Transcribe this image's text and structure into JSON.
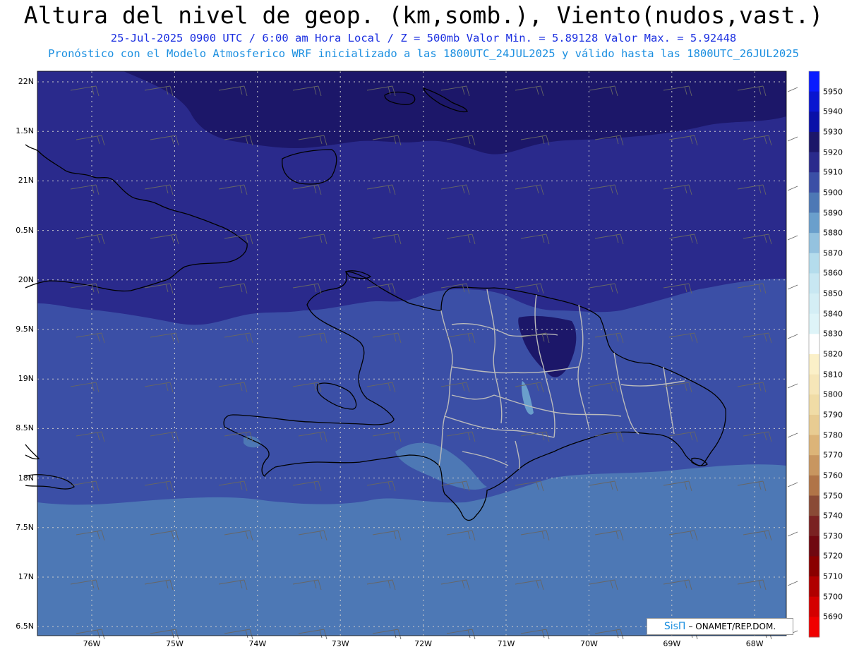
{
  "header": {
    "title": "Altura del nivel de geop. (km,somb.), Viento(nudos,vast.)",
    "subtitle1": "25-Jul-2025   0900 UTC / 6:00 am Hora Local / Z = 500mb     Valor Min. = 5.89128  Valor Max. = 5.92448",
    "subtitle2": "Pronóstico con el Modelo Atmosferico WRF inicializado a las 1800UTC_24JUL2025 y válido hasta las  1800UTC_26JUL2025"
  },
  "map": {
    "lat_labels": [
      "22N",
      "1.5N",
      "21N",
      "0.5N",
      "20N",
      "9.5N",
      "19N",
      "8.5N",
      "18N",
      "7.5N",
      "17N",
      "6.5N"
    ],
    "lon_labels": [
      "76W",
      "75W",
      "74W",
      "73W",
      "72W",
      "71W",
      "70W",
      "69W",
      "68W"
    ],
    "colors": {
      "band_5920": "#1c1769",
      "band_5910": "#2a2a8c",
      "band_5900": "#3b4fa6",
      "band_5890": "#4d78b5",
      "band_5880": "#6a9fcc",
      "grid": "#cccccc",
      "coast": "#000000",
      "borders": "#bbbbbb"
    }
  },
  "colorbar": {
    "levels": [
      "5950",
      "5940",
      "5930",
      "5920",
      "5910",
      "5900",
      "5890",
      "5880",
      "5870",
      "5860",
      "5850",
      "5840",
      "5830",
      "5820",
      "5810",
      "5800",
      "5790",
      "5780",
      "5770",
      "5760",
      "5750",
      "5740",
      "5730",
      "5720",
      "5710",
      "5700",
      "5690"
    ],
    "colors": [
      "#0a1cff",
      "#0a16d0",
      "#0a10a8",
      "#1c1769",
      "#2a2a8c",
      "#3b4fa6",
      "#4d78b5",
      "#6a9fcc",
      "#94c2df",
      "#b4dcec",
      "#c8e7f2",
      "#d4eef5",
      "#def4f8",
      "#ffffff",
      "#fbf0c8",
      "#f6e6b8",
      "#f0dca6",
      "#e8cc92",
      "#dcb478",
      "#c89660",
      "#b07448",
      "#8a4a36",
      "#7a2222",
      "#700810",
      "#8a0000",
      "#b00000",
      "#d40000",
      "#f00000"
    ]
  },
  "credit": {
    "brand": "SisΠ",
    "text": "– ONAMET/REP.DOM."
  }
}
